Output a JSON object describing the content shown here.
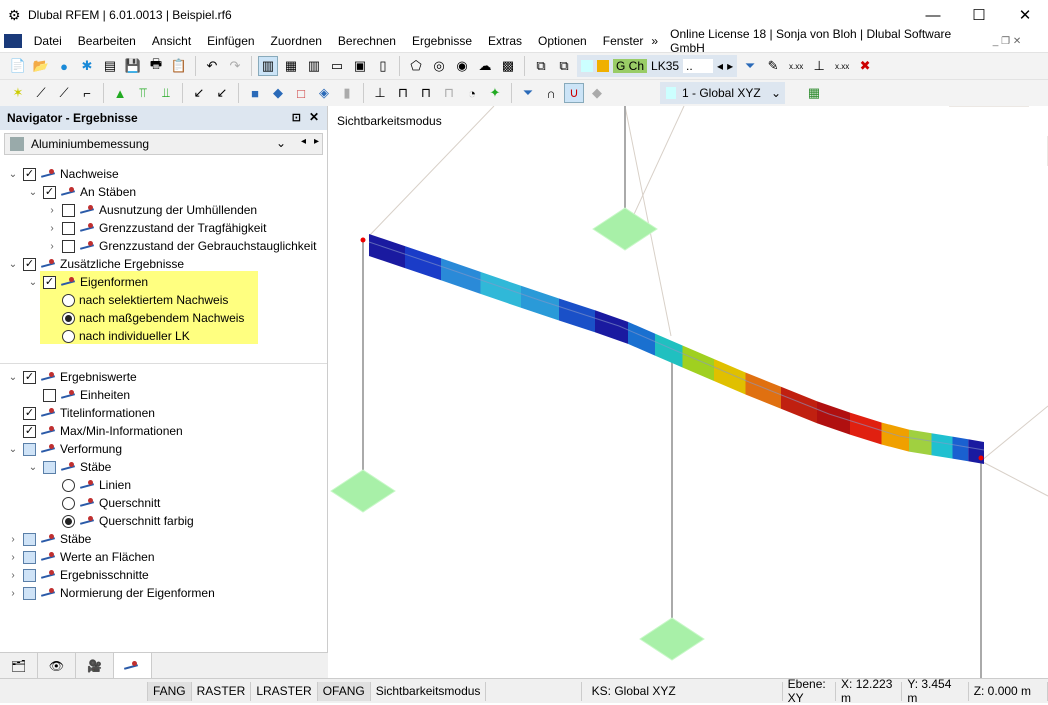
{
  "window": {
    "title": "Dlubal RFEM | 6.01.0013 | Beispiel.rf6",
    "minimize": "—",
    "maximize": "☐",
    "close": "✕"
  },
  "menu": {
    "items": [
      "Datei",
      "Bearbeiten",
      "Ansicht",
      "Einfügen",
      "Zuordnen",
      "Berechnen",
      "Ergebnisse",
      "Extras",
      "Optionen",
      "Fenster"
    ],
    "overflow": "»",
    "license": "Online License 18 | Sonja von Bloh | Dlubal Software GmbH"
  },
  "toolbar": {
    "load_combo_type": "G Ch",
    "load_case": "LK35",
    "load_case_more": "..",
    "view_select": "1 - Global XYZ"
  },
  "navigator": {
    "title": "Navigator - Ergebnisse",
    "module": "Aluminiumbemessung",
    "tree": [
      {
        "label": "Nachweise",
        "level": 0,
        "exp": "v",
        "check": "on"
      },
      {
        "label": "An Stäben",
        "level": 1,
        "exp": "v",
        "check": "on"
      },
      {
        "label": "Ausnutzung der Umhüllenden",
        "level": 2,
        "exp": ">",
        "check": "off"
      },
      {
        "label": "Grenzzustand der Tragfähigkeit",
        "level": 2,
        "exp": ">",
        "check": "off"
      },
      {
        "label": "Grenzzustand der Gebrauchstauglichkeit",
        "level": 2,
        "exp": ">",
        "check": "off"
      },
      {
        "label": "Zusätzliche Ergebnisse",
        "level": 0,
        "exp": "v",
        "check": "on"
      },
      {
        "label": "Eigenformen",
        "level": 1,
        "exp": "v",
        "check": "on"
      },
      {
        "label": "nach selektiertem Nachweis",
        "level": 2,
        "radio": "off"
      },
      {
        "label": "nach maßgebendem Nachweis",
        "level": 2,
        "radio": "on"
      },
      {
        "label": "nach individueller LK",
        "level": 2,
        "radio": "off"
      }
    ],
    "tree2": [
      {
        "label": "Ergebniswerte",
        "level": 0,
        "exp": "v",
        "check": "on"
      },
      {
        "label": "Einheiten",
        "level": 1,
        "check": "off"
      },
      {
        "label": "Titelinformationen",
        "level": 0,
        "check": "on"
      },
      {
        "label": "Max/Min-Informationen",
        "level": 0,
        "check": "on"
      },
      {
        "label": "Verformung",
        "level": 0,
        "exp": "v",
        "check": "part"
      },
      {
        "label": "Stäbe",
        "level": 1,
        "exp": "v",
        "check": "part"
      },
      {
        "label": "Linien",
        "level": 2,
        "radio": "off"
      },
      {
        "label": "Querschnitt",
        "level": 2,
        "radio": "off"
      },
      {
        "label": "Querschnitt farbig",
        "level": 2,
        "radio": "on"
      },
      {
        "label": "Stäbe",
        "level": 0,
        "exp": ">",
        "check": "part"
      },
      {
        "label": "Werte an Flächen",
        "level": 0,
        "exp": ">",
        "check": "part"
      },
      {
        "label": "Ergebnisschnitte",
        "level": 0,
        "exp": ">",
        "check": "part"
      },
      {
        "label": "Normierung der Eigenformen",
        "level": 0,
        "exp": ">",
        "check": "part"
      }
    ]
  },
  "viewport": {
    "mode_label": "Sichtbarkeitsmodus",
    "support_color": "#a8f0a8",
    "beam_colors": [
      "#1a1aa0",
      "#1a3cc8",
      "#2a8ad8",
      "#30b8d8",
      "#2a9ad8",
      "#1a50c8",
      "#1a1aa0",
      "#1a70d0",
      "#20c0c0",
      "#a0d020",
      "#e0c000",
      "#e07010",
      "#c02010",
      "#b01010",
      "#e02010",
      "#f0a000",
      "#a0d040",
      "#20c0d0",
      "#1a60d0",
      "#1a1aa0"
    ]
  },
  "status": {
    "items": [
      "FANG",
      "RASTER",
      "LRASTER",
      "OFANG",
      "Sichtbarkeitsmodus"
    ],
    "active": [
      "FANG",
      "OFANG"
    ],
    "ks": "KS: Global XYZ",
    "ebene": "Ebene: XY",
    "x": "X: 12.223 m",
    "y": "Y: 3.454 m",
    "z": "Z: 0.000 m"
  }
}
